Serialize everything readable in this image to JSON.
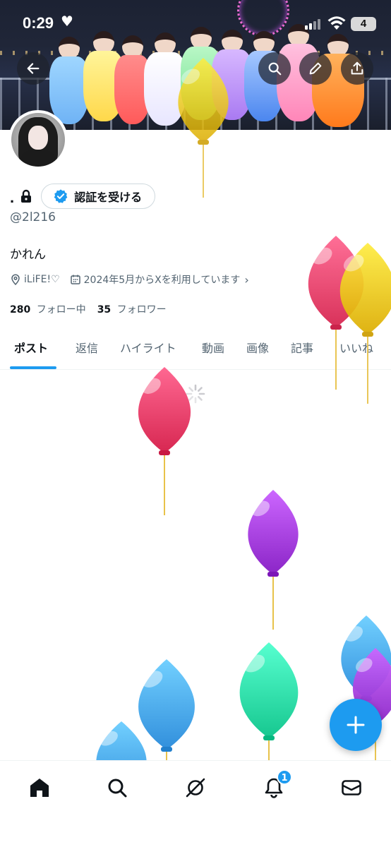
{
  "status_bar": {
    "time": "0:29",
    "battery": "4"
  },
  "profile": {
    "display_name": ".",
    "verify_label": "認証を受ける",
    "handle": "@2l216",
    "bio": "かれん",
    "location": "iLiFE!♡",
    "joined": "2024年5月からXを利用しています",
    "following_count": "280",
    "following_label": "フォロー中",
    "followers_count": "35",
    "followers_label": "フォロワー"
  },
  "tabs": [
    "ポスト",
    "返信",
    "ハイライト",
    "動画",
    "画像",
    "記事",
    "いいね"
  ],
  "active_tab": "ポスト",
  "notifications": {
    "badge": "1"
  },
  "colors": {
    "accent": "#1d9bf0",
    "balloon_yellow": "#f5c518",
    "balloon_red": "#f0406a",
    "balloon_purple": "#a43ee0",
    "balloon_blue": "#4aa8f5",
    "balloon_green": "#2fe0a8"
  },
  "icons": {
    "header": [
      "back-arrow-icon",
      "search-icon",
      "edit-pencil-icon",
      "share-icon"
    ],
    "nav": [
      "home-icon",
      "search-icon",
      "grok-icon",
      "bell-icon",
      "mail-icon"
    ]
  }
}
